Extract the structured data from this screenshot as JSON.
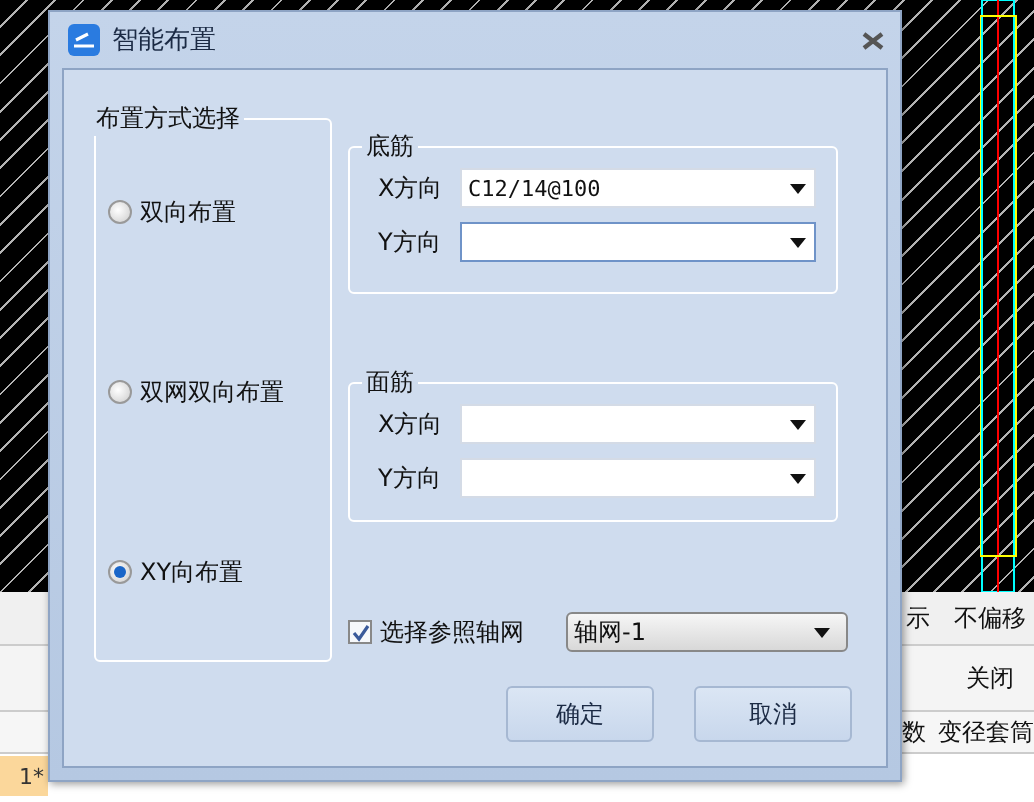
{
  "background": {
    "toolbar_1": [
      "示",
      "不偏移"
    ],
    "toolbar_2": [
      "关闭"
    ],
    "grid_header": [
      "数",
      "变径套筒"
    ],
    "row_header": "1*"
  },
  "dialog": {
    "title": "智能布置",
    "mode_group": {
      "title": "布置方式选择",
      "options": [
        {
          "label": "双向布置",
          "selected": false
        },
        {
          "label": "双网双向布置",
          "selected": false
        },
        {
          "label": "XY向布置",
          "selected": true
        }
      ]
    },
    "groups": [
      {
        "title": "底筋",
        "fields": [
          {
            "label": "X方向",
            "value": "C12/14@100",
            "focused": false
          },
          {
            "label": "Y方向",
            "focused": true
          }
        ]
      },
      {
        "title": "面筋",
        "fields": [
          {
            "label": "X方向",
            "focused": false
          },
          {
            "label": "Y方向",
            "focused": false
          }
        ]
      }
    ],
    "reference": {
      "label": "选择参照轴网",
      "checked": true,
      "value": "轴网-1"
    },
    "buttons": [
      "确定",
      "取消"
    ]
  }
}
